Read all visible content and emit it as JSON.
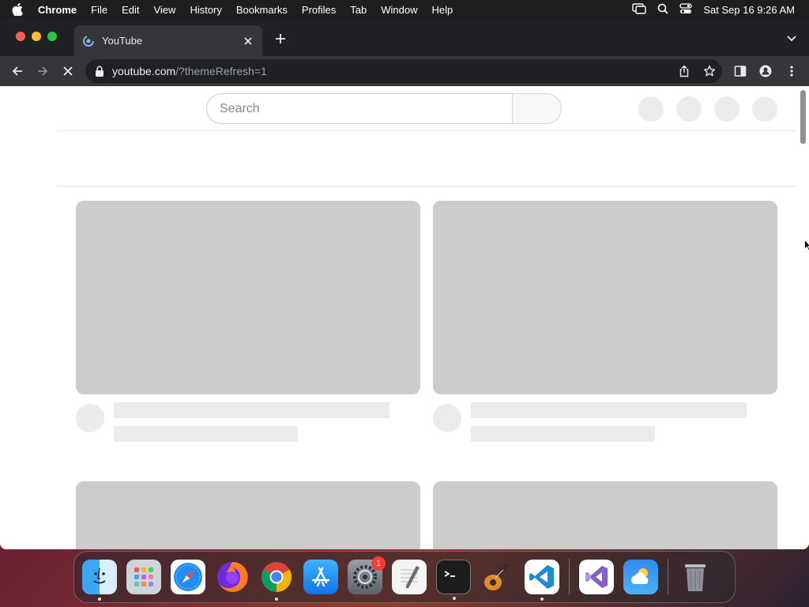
{
  "menubar": {
    "app_name": "Chrome",
    "items": [
      "File",
      "Edit",
      "View",
      "History",
      "Bookmarks",
      "Profiles",
      "Tab",
      "Window",
      "Help"
    ],
    "clock": "Sat Sep 16  9:26 AM"
  },
  "browser": {
    "tab_title": "YouTube",
    "url_host": "youtube.com",
    "url_path": "/?themeRefresh=1"
  },
  "youtube": {
    "search_placeholder": "Search"
  },
  "dock": {
    "apps": [
      "finder-icon",
      "launchpad-icon",
      "safari-icon",
      "firefox-icon",
      "chrome-icon",
      "app-store-icon",
      "system-settings-icon",
      "textedit-icon",
      "terminal-icon",
      "garageband-icon",
      "vscode-icon",
      "visual-studio-icon",
      "weather-icon",
      "trash-icon"
    ],
    "system_settings_badge": "1"
  },
  "colors": {
    "menubar_bg": "#1e1e1e",
    "tabstrip_bg": "#202124",
    "toolbar_bg": "#35363a",
    "skeleton_thumb": "#cccccc",
    "skeleton_line": "#ebebeb"
  }
}
